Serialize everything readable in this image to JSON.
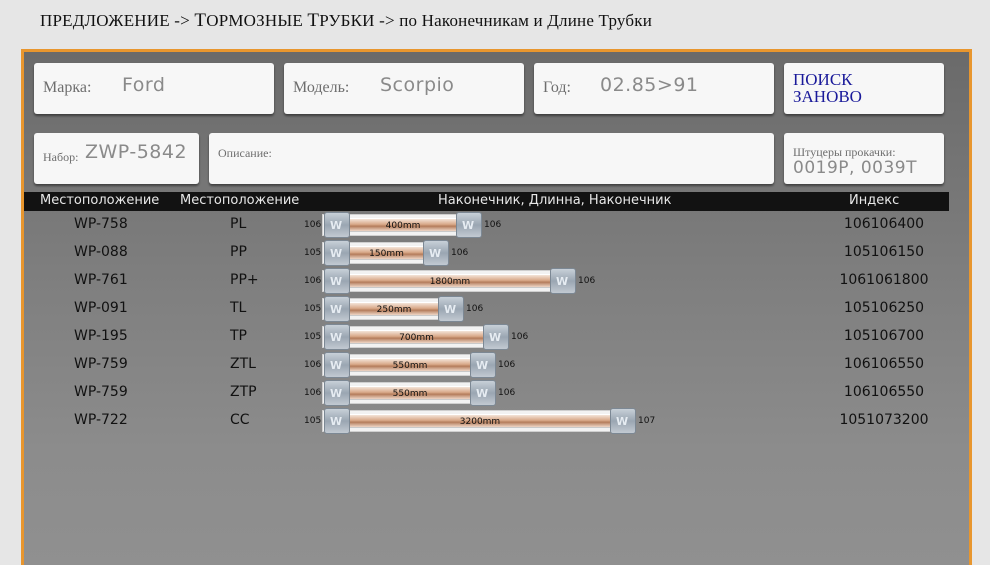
{
  "breadcrumb": {
    "part1": "ПРЕДЛОЖЕНИЕ -> ",
    "part2": "Т",
    "part3": "ОРМОЗНЫЕ ",
    "part4": "Т",
    "part5": "РУБКИ -> по Наконечникам и Длине Трубки"
  },
  "filters": {
    "make": {
      "label": "Марка:",
      "value": "Ford"
    },
    "model": {
      "label": "Модель:",
      "value": "Scorpio"
    },
    "year": {
      "label": "Год:",
      "value": "02.85>91"
    },
    "reset": {
      "label_line1": "ПОИСК",
      "label_line2": "ЗАНОВО"
    },
    "kit": {
      "label": "Набор:",
      "value": "ZWP-5842"
    },
    "description": {
      "label": "Описание:",
      "value": ""
    },
    "bleed": {
      "label": "Штуцеры прокачки:",
      "value": "0019P, 0039T"
    }
  },
  "table": {
    "headers": [
      "Местоположение",
      "Местоположение",
      "Наконечник, Длинна, Наконечник",
      "Индекс"
    ],
    "rows": [
      {
        "code": "WP-758",
        "pos": "PL",
        "left": "106",
        "length_label": "400mm",
        "right": "106",
        "index": "106106400",
        "length_mm": 400
      },
      {
        "code": "WP-088",
        "pos": "PP",
        "left": "105",
        "length_label": "150mm",
        "right": "106",
        "index": "105106150",
        "length_mm": 150
      },
      {
        "code": "WP-761",
        "pos": "PP+",
        "left": "106",
        "length_label": "1800mm",
        "right": "106",
        "index": "1061061800",
        "length_mm": 1800
      },
      {
        "code": "WP-091",
        "pos": "TL",
        "left": "105",
        "length_label": "250mm",
        "right": "106",
        "index": "105106250",
        "length_mm": 250
      },
      {
        "code": "WP-195",
        "pos": "TP",
        "left": "105",
        "length_label": "700mm",
        "right": "106",
        "index": "105106700",
        "length_mm": 700
      },
      {
        "code": "WP-759",
        "pos": "ZTL",
        "left": "106",
        "length_label": "550mm",
        "right": "106",
        "index": "106106550",
        "length_mm": 550
      },
      {
        "code": "WP-759",
        "pos": "ZTP",
        "left": "106",
        "length_label": "550mm",
        "right": "106",
        "index": "106106550",
        "length_mm": 550
      },
      {
        "code": "WP-722",
        "pos": "CC",
        "left": "105",
        "length_label": "3200mm",
        "right": "107",
        "index": "1051073200",
        "length_mm": 3200
      }
    ]
  },
  "colors": {
    "accent_border": "#e8962e",
    "reset_text": "#1a1a9a"
  }
}
